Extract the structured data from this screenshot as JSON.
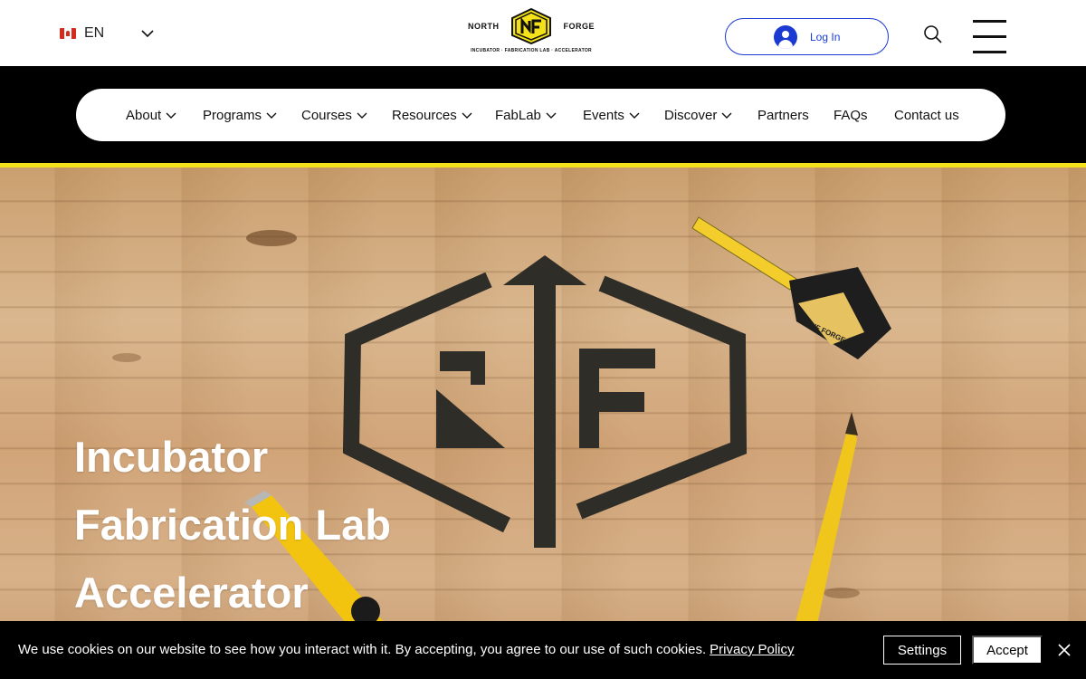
{
  "header": {
    "language": {
      "code": "EN",
      "flag_icon": "canada-flag-icon",
      "menu_icon": "chevron-down-icon"
    },
    "logo": {
      "left_word": "NORTH",
      "right_word": "FORGE",
      "mark": "NF",
      "tagline": "INCUBATOR · FABRICATION LAB · ACCELERATOR"
    },
    "login": {
      "label": "Log In",
      "icon": "user-avatar-icon"
    },
    "search": {
      "icon": "search-icon"
    },
    "menu": {
      "icon": "hamburger-menu-icon"
    }
  },
  "nav": {
    "items": [
      {
        "label": "About",
        "has_dropdown": true
      },
      {
        "label": "Programs",
        "has_dropdown": true
      },
      {
        "label": "Courses",
        "has_dropdown": true
      },
      {
        "label": "Resources",
        "has_dropdown": true
      },
      {
        "label": "FabLab",
        "has_dropdown": true
      },
      {
        "label": "Events",
        "has_dropdown": true
      },
      {
        "label": "Discover",
        "has_dropdown": true
      },
      {
        "label": "Partners",
        "has_dropdown": false
      },
      {
        "label": "FAQs",
        "has_dropdown": false
      },
      {
        "label": "Contact us",
        "has_dropdown": false
      }
    ]
  },
  "hero": {
    "lines": [
      "Incubator",
      "Fabrication Lab",
      "Accelerator"
    ],
    "image_marks": {
      "tape_text": "NF FORGE",
      "logo_mark": "NF"
    }
  },
  "cookie": {
    "message": "We use cookies on our website to see how you interact with it. By accepting, you agree to our use of such cookies.",
    "link": "Privacy Policy",
    "settings_label": "Settings",
    "accept_label": "Accept",
    "close_icon": "close-icon"
  },
  "colors": {
    "brand_yellow": "#f5e11a",
    "link_blue": "#1a3ad1",
    "nav_band": "#000000",
    "wood": "#d2aa7e"
  }
}
